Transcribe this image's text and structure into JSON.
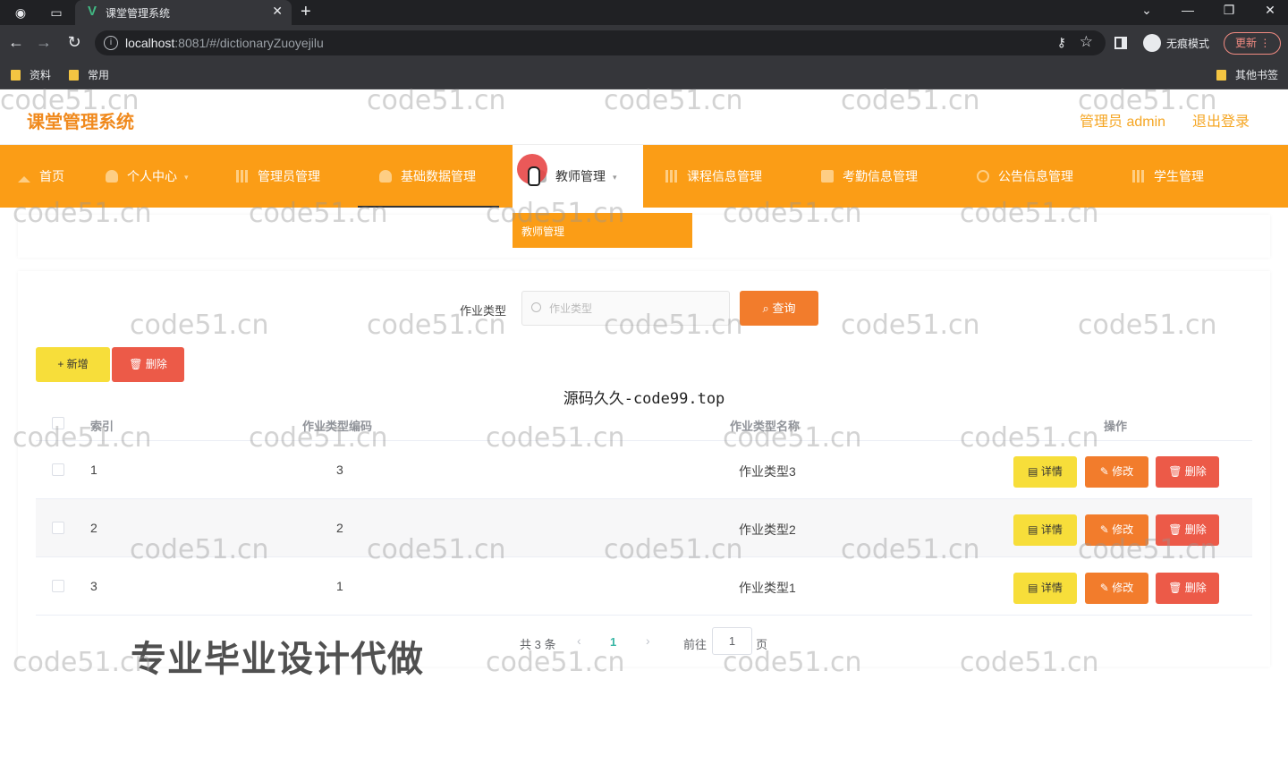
{
  "browser": {
    "tab_title": "课堂管理系统",
    "url_host": "localhost",
    "url_rest": ":8081/#/dictionaryZuoyejilu",
    "incognito_label": "无痕模式",
    "update_label": "更新",
    "bookmarks": [
      "资料",
      "常用"
    ],
    "other_bookmarks": "其他书签"
  },
  "header": {
    "app_title": "课堂管理系统",
    "admin_label": "管理员 admin",
    "logout_label": "退出登录"
  },
  "nav": {
    "items": [
      {
        "label": "首页",
        "icon": "house-icon"
      },
      {
        "label": "个人中心",
        "icon": "person-icon"
      },
      {
        "label": "管理员管理",
        "icon": "grid-icon"
      },
      {
        "label": "基础数据管理",
        "icon": "person-icon"
      },
      {
        "label": "教师管理",
        "icon": "person-icon"
      },
      {
        "label": "课程信息管理",
        "icon": "grid-icon"
      },
      {
        "label": "考勤信息管理",
        "icon": "calendar-icon"
      },
      {
        "label": "公告信息管理",
        "icon": "bell-icon"
      },
      {
        "label": "学生管理",
        "icon": "grid-icon"
      }
    ],
    "dropdown_item": "教师管理"
  },
  "search": {
    "label": "作业类型",
    "placeholder": "作业类型",
    "button_label": "查询"
  },
  "actions": {
    "add_label": "新增",
    "delete_label": "删除"
  },
  "caption": "源码久久-code99.top",
  "table": {
    "headers": {
      "index": "索引",
      "code": "作业类型编码",
      "name": "作业类型名称",
      "ops": "操作"
    },
    "rows": [
      {
        "index": "1",
        "code": "3",
        "name": "作业类型3"
      },
      {
        "index": "2",
        "code": "2",
        "name": "作业类型2"
      },
      {
        "index": "3",
        "code": "1",
        "name": "作业类型1"
      }
    ],
    "op_detail": "详情",
    "op_edit": "修改",
    "op_delete": "删除"
  },
  "pagination": {
    "total": "共 3 条",
    "current_page": "1",
    "goto_label": "前往",
    "goto_value": "1",
    "page_label": "页"
  },
  "promo_text": "专业毕业设计代做",
  "watermark": "code51.cn",
  "colors": {
    "nav_bg": "#fb9d16",
    "title": "#f08a1e",
    "query_btn": "#f27c2c",
    "add_btn": "#f7de3a",
    "delete_btn": "#ec5a48",
    "page_active": "#3ab7a6"
  }
}
